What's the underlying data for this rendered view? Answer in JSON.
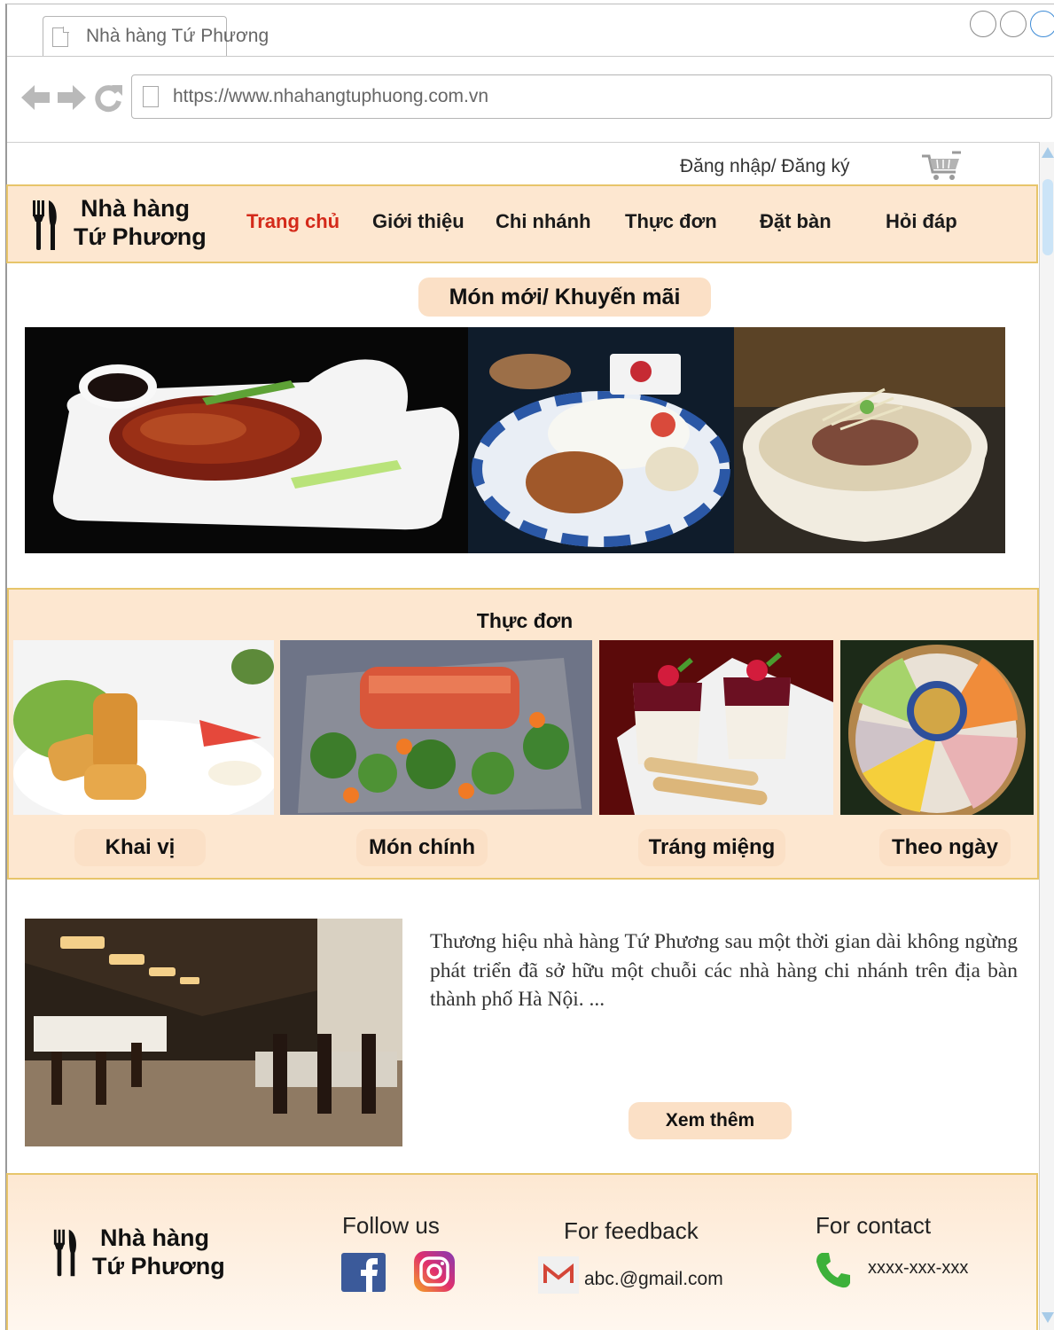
{
  "browser": {
    "tab_title": "Nhà hàng Tứ Phương",
    "url": "https://www.nhahangtuphuong.com.vn"
  },
  "topbar": {
    "login_label": "Đăng nhập/ Đăng ký",
    "cart_icon": "shopping-cart-icon"
  },
  "header": {
    "brand_line1": "Nhà hàng",
    "brand_line2": "Tứ Phương",
    "nav": [
      "Trang chủ",
      "Giới thiệu",
      "Chi nhánh",
      "Thực đơn",
      "Đặt bàn",
      "Hỏi đáp"
    ],
    "active_nav": "Trang chủ",
    "active_color": "#d42a1a"
  },
  "promo": {
    "title": "Món mới/ Khuyến mãi"
  },
  "menu": {
    "title": "Thực đơn",
    "categories": [
      "Khai vị",
      "Món chính",
      "Tráng miệng",
      "Theo ngày"
    ]
  },
  "about": {
    "text": "Thương hiệu nhà hàng Tứ Phương sau một thời gian dài không ngừng phát triển đã sở hữu một chuỗi các nhà hàng chi nhánh trên địa bàn thành phố Hà Nội. ...",
    "more_label": "Xem thêm"
  },
  "footer": {
    "brand_line1": "Nhà hàng",
    "brand_line2": "Tứ Phương",
    "follow_title": "Follow us",
    "feedback_title": "For feedback",
    "feedback_email": "abc.@gmail.com",
    "contact_title": "For contact",
    "contact_phone": "xxxx-xxx-xxx"
  },
  "colors": {
    "section_bg": "#fde7d0",
    "border": "#e7c56a",
    "pill_bg": "#fbe0c6"
  }
}
